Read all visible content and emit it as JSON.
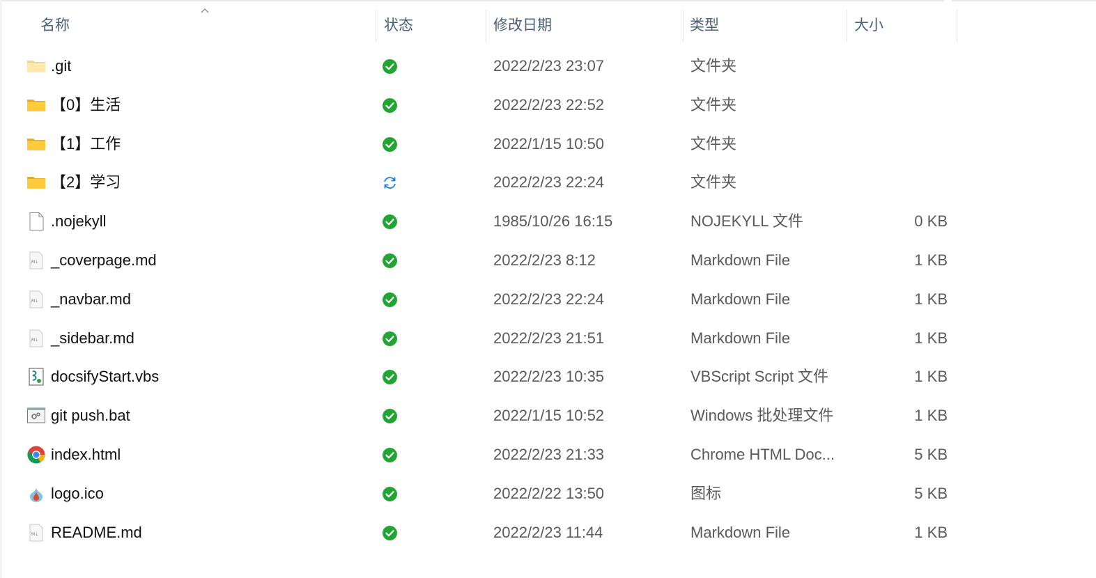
{
  "columns": {
    "name": "名称",
    "status": "状态",
    "modified": "修改日期",
    "type": "类型",
    "size": "大小"
  },
  "files": [
    {
      "name": ".git",
      "icon": "folder-light-icon",
      "status": "synced",
      "modified": "2022/2/23 23:07",
      "type": "文件夹",
      "size": ""
    },
    {
      "name": "【0】生活",
      "icon": "folder-icon",
      "status": "synced",
      "modified": "2022/2/23 22:52",
      "type": "文件夹",
      "size": ""
    },
    {
      "name": "【1】工作",
      "icon": "folder-icon",
      "status": "synced",
      "modified": "2022/1/15 10:50",
      "type": "文件夹",
      "size": ""
    },
    {
      "name": "【2】学习",
      "icon": "folder-icon",
      "status": "syncing",
      "modified": "2022/2/23 22:24",
      "type": "文件夹",
      "size": ""
    },
    {
      "name": ".nojekyll",
      "icon": "blank-file-icon",
      "status": "synced",
      "modified": "1985/10/26 16:15",
      "type": "NOJEKYLL 文件",
      "size": "0 KB"
    },
    {
      "name": "_coverpage.md",
      "icon": "markdown-file-icon",
      "status": "synced",
      "modified": "2022/2/23 8:12",
      "type": "Markdown File",
      "size": "1 KB"
    },
    {
      "name": "_navbar.md",
      "icon": "markdown-file-icon",
      "status": "synced",
      "modified": "2022/2/23 22:24",
      "type": "Markdown File",
      "size": "1 KB"
    },
    {
      "name": "_sidebar.md",
      "icon": "markdown-file-icon",
      "status": "synced",
      "modified": "2022/2/23 21:51",
      "type": "Markdown File",
      "size": "1 KB"
    },
    {
      "name": "docsifyStart.vbs",
      "icon": "vbscript-file-icon",
      "status": "synced",
      "modified": "2022/2/23 10:35",
      "type": "VBScript Script 文件",
      "size": "1 KB"
    },
    {
      "name": "git push.bat",
      "icon": "batch-file-icon",
      "status": "synced",
      "modified": "2022/1/15 10:52",
      "type": "Windows 批处理文件",
      "size": "1 KB"
    },
    {
      "name": "index.html",
      "icon": "chrome-icon",
      "status": "synced",
      "modified": "2022/2/23 21:33",
      "type": "Chrome HTML Doc...",
      "size": "5 KB"
    },
    {
      "name": "logo.ico",
      "icon": "ico-file-icon",
      "status": "synced",
      "modified": "2022/2/22 13:50",
      "type": "图标",
      "size": "5 KB"
    },
    {
      "name": "README.md",
      "icon": "markdown-file-icon",
      "status": "synced",
      "modified": "2022/2/23 11:44",
      "type": "Markdown File",
      "size": "1 KB"
    }
  ],
  "colors": {
    "header_text": "#4c6079",
    "synced_green": "#22a535",
    "syncing_blue": "#1e7fd8",
    "folder_yellow": "#ffcb3d"
  }
}
